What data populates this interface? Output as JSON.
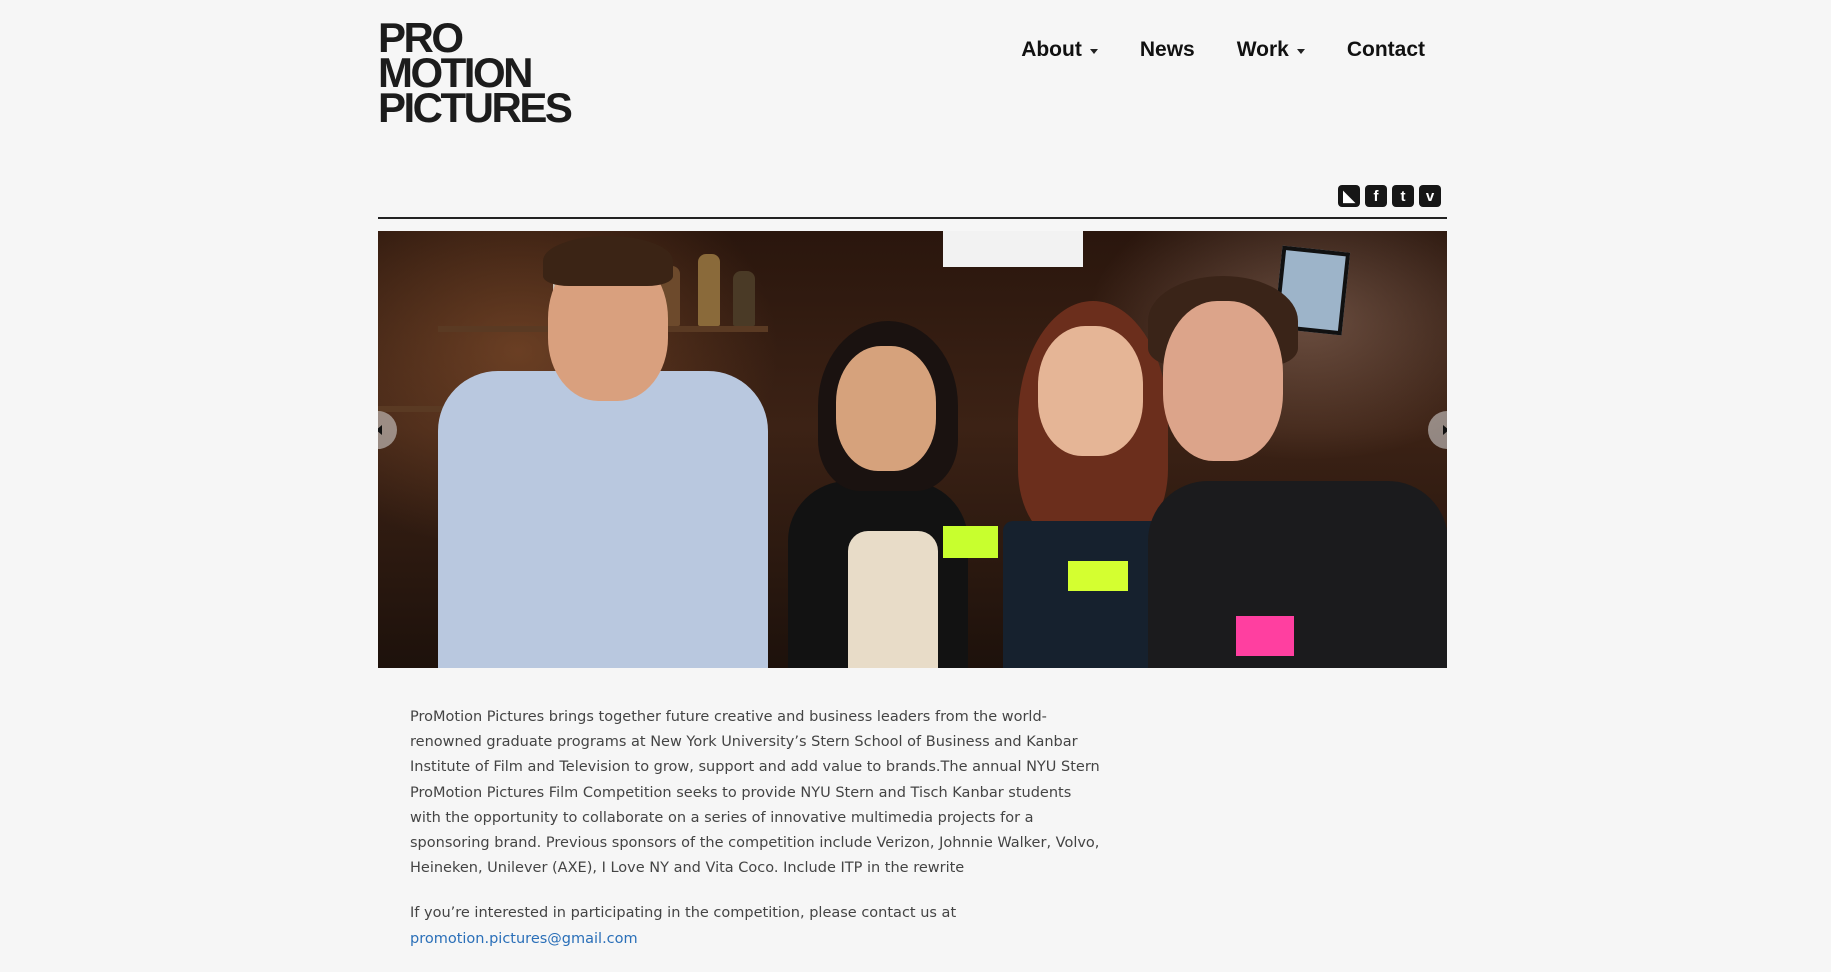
{
  "logo": {
    "lines": [
      "PRO",
      "MOTION",
      "PICTURES"
    ]
  },
  "nav": {
    "items": [
      {
        "label": "About",
        "has_dropdown": true
      },
      {
        "label": "News",
        "has_dropdown": false
      },
      {
        "label": "Work",
        "has_dropdown": true
      },
      {
        "label": "Contact",
        "has_dropdown": false
      }
    ]
  },
  "social": {
    "icons": [
      {
        "name": "rss-icon",
        "glyph": "◣"
      },
      {
        "name": "facebook-icon",
        "glyph": "f"
      },
      {
        "name": "twitter-icon",
        "glyph": "t"
      },
      {
        "name": "vimeo-icon",
        "glyph": "v"
      }
    ]
  },
  "slider": {
    "image": "group-photo-at-bar"
  },
  "content": {
    "intro": "ProMotion Pictures brings together future creative and business leaders from the world-renowned graduate programs at New York University’s Stern School of Business and Kanbar Institute of Film and Television to grow, support and add value to brands.The annual NYU Stern ProMotion Pictures Film Competition seeks to provide NYU Stern and Tisch Kanbar students with the opportunity to collaborate on a series of innovative multimedia projects for a sponsoring brand. Previous sponsors of the competition include Verizon, Johnnie Walker, Volvo, Heineken, Unilever (AXE), I Love NY and Vita Coco.  Include ITP in the rewrite",
    "contact_text": "If you’re interested in participating in the competition, please contact us at",
    "contact_email": "promotion.pictures@gmail.com"
  },
  "colors": {
    "background": "#f6f6f6",
    "text": "#444444",
    "link": "#2a6fb8",
    "nav": "#111111"
  }
}
